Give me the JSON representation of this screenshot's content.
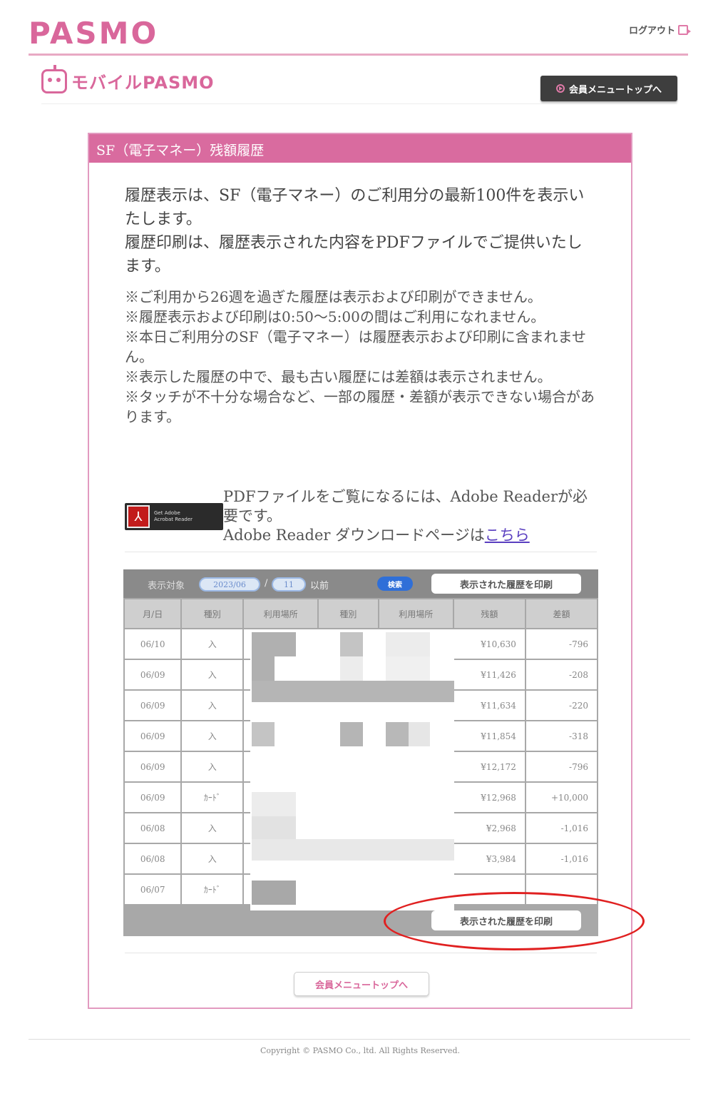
{
  "header": {
    "logo": "PASMO",
    "logout_label": "ログアウト"
  },
  "subheader": {
    "mobile_logo": "モバイルPASMO",
    "member_top_label": "会員メニュートップへ"
  },
  "panel": {
    "title": "SF（電子マネー）残額履歴",
    "intro": [
      "履歴表示は、SF（電子マネー）のご利用分の最新100件を表示いたします。",
      "履歴印刷は、履歴表示された内容をPDFファイルでご提供いたします。"
    ],
    "notes": [
      "※ご利用から26週を過ぎた履歴は表示および印刷ができません。",
      "※履歴表示および印刷は0:50〜5:00の間はご利用になれません。",
      "※本日ご利用分のSF（電子マネー）は履歴表示および印刷に含まれません。",
      "※表示した履歴の中で、最も古い履歴には差額は表示されません。",
      "※タッチが不十分な場合など、一部の履歴・差額が表示できない場合があります。"
    ],
    "adobe": {
      "badge_text_1": "Get Adobe",
      "badge_text_2": "Acrobat Reader",
      "line1": "PDFファイルをご覧になるには、Adobe Readerが必要です。",
      "line2_prefix": "Adobe Reader ダウンロードページは",
      "link": "こちら"
    }
  },
  "filter": {
    "label": "表示対象",
    "date_value": "2023/06",
    "sep": "/",
    "day_value": "11",
    "after_label": "以前",
    "search_label": "検索",
    "print_label": "表示された履歴を印刷"
  },
  "table": {
    "headers": [
      "月/日",
      "種別",
      "利用場所",
      "種別",
      "利用場所",
      "残額",
      "差額"
    ],
    "rows": [
      {
        "date": "06/10",
        "type": "入",
        "balance": "¥10,630",
        "diff": "-796"
      },
      {
        "date": "06/09",
        "type": "入",
        "balance": "¥11,426",
        "diff": "-208"
      },
      {
        "date": "06/09",
        "type": "入",
        "balance": "¥11,634",
        "diff": "-220"
      },
      {
        "date": "06/09",
        "type": "入",
        "balance": "¥11,854",
        "diff": "-318"
      },
      {
        "date": "06/09",
        "type": "入",
        "balance": "¥12,172",
        "diff": "-796"
      },
      {
        "date": "06/09",
        "type": "ｶｰﾄﾞ",
        "balance": "¥12,968",
        "diff": "+10,000"
      },
      {
        "date": "06/08",
        "type": "入",
        "balance": "¥2,968",
        "diff": "-1,016"
      },
      {
        "date": "06/08",
        "type": "入",
        "balance": "¥3,984",
        "diff": "-1,016"
      },
      {
        "date": "06/07",
        "type": "ｶｰﾄﾞ",
        "balance": "",
        "diff": ""
      }
    ]
  },
  "bottom": {
    "member_top_label": "会員メニュートップへ"
  },
  "footer": {
    "copyright": "Copyright © PASMO Co., ltd. All Rights Reserved."
  },
  "colors": {
    "brand_pink": "#d9679b",
    "annotation_red": "#e02020"
  }
}
